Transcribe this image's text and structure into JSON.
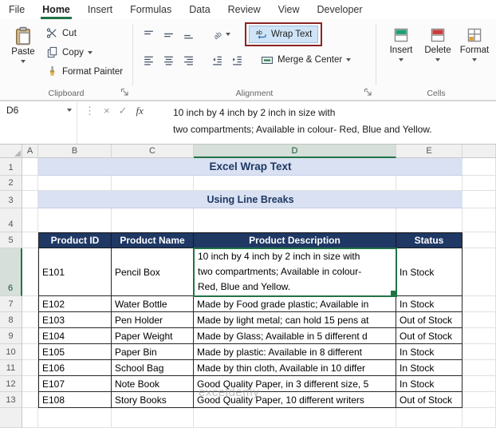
{
  "ribbon": {
    "tabs": [
      {
        "label": "File"
      },
      {
        "label": "Home",
        "active": true
      },
      {
        "label": "Insert"
      },
      {
        "label": "Formulas"
      },
      {
        "label": "Data"
      },
      {
        "label": "Review"
      },
      {
        "label": "View"
      },
      {
        "label": "Developer"
      }
    ],
    "clipboard": {
      "group_label": "Clipboard",
      "paste_label": "Paste",
      "cut_label": "Cut",
      "copy_label": "Copy",
      "format_painter_label": "Format Painter"
    },
    "alignment": {
      "group_label": "Alignment",
      "wrap_text_label": "Wrap Text",
      "merge_center_label": "Merge & Center"
    },
    "cells": {
      "group_label": "Cells",
      "insert_label": "Insert",
      "delete_label": "Delete",
      "format_label": "Format"
    }
  },
  "formula_bar": {
    "name_box": "D6",
    "fx_label": "fx",
    "cancel_glyph": "×",
    "enter_glyph": "✓",
    "more_glyph": "⋮",
    "line1": "10 inch by 4 inch by 2 inch in size with",
    "line2": "two compartments; Available in colour- Red, Blue and Yellow."
  },
  "sheet": {
    "column_headers": [
      "A",
      "B",
      "C",
      "D",
      "E"
    ],
    "row_numbers": [
      "1",
      "2",
      "3",
      "4",
      "5",
      "6"
    ],
    "selected_cell": "D6",
    "title": "Excel Wrap Text",
    "subtitle": "Using Line Breaks",
    "watermark": "exceldemy",
    "table": {
      "headers": [
        "Product ID",
        "Product Name",
        "Product Description",
        "Status"
      ],
      "row6": {
        "row": "6",
        "id": "E101",
        "name": "Pencil Box",
        "desc_lines": [
          "10 inch by 4 inch by 2 inch in size with",
          "two compartments; Available in colour-",
          "Red, Blue and Yellow."
        ],
        "status": "In Stock"
      },
      "rows": [
        {
          "row": "7",
          "id": "E102",
          "name": "Water Bottle",
          "description": "Made by Food grade plastic; Available in",
          "status": "In Stock"
        },
        {
          "row": "8",
          "id": "E103",
          "name": "Pen Holder",
          "description": "Made by light metal; can hold 15 pens at",
          "status": "Out of Stock"
        },
        {
          "row": "9",
          "id": "E104",
          "name": "Paper Weight",
          "description": "Made by Glass; Available in 5 different d",
          "status": "Out of Stock"
        },
        {
          "row": "10",
          "id": "E105",
          "name": "Paper Bin",
          "description": "Made by plastic: Available in 8 different",
          "status": "In Stock"
        },
        {
          "row": "11",
          "id": "E106",
          "name": "School Bag",
          "description": "Made by thin cloth, Available in 10 differ",
          "status": "In Stock"
        },
        {
          "row": "12",
          "id": "E107",
          "name": "Note Book",
          "description": "Good Quality Paper, in 3 different size, 5",
          "status": "In Stock"
        },
        {
          "row": "13",
          "id": "E108",
          "name": "Story Books",
          "description": "Good Quality Paper, 10 different writers",
          "status": "Out of Stock"
        }
      ]
    }
  },
  "colors": {
    "excel_green": "#217346",
    "table_header_navy": "#1f3864",
    "title_fill": "#d9e1f2",
    "title_text": "#1f3864",
    "annotation_red": "#8b2323",
    "wrap_text_active_fill": "#cfe4f7"
  }
}
